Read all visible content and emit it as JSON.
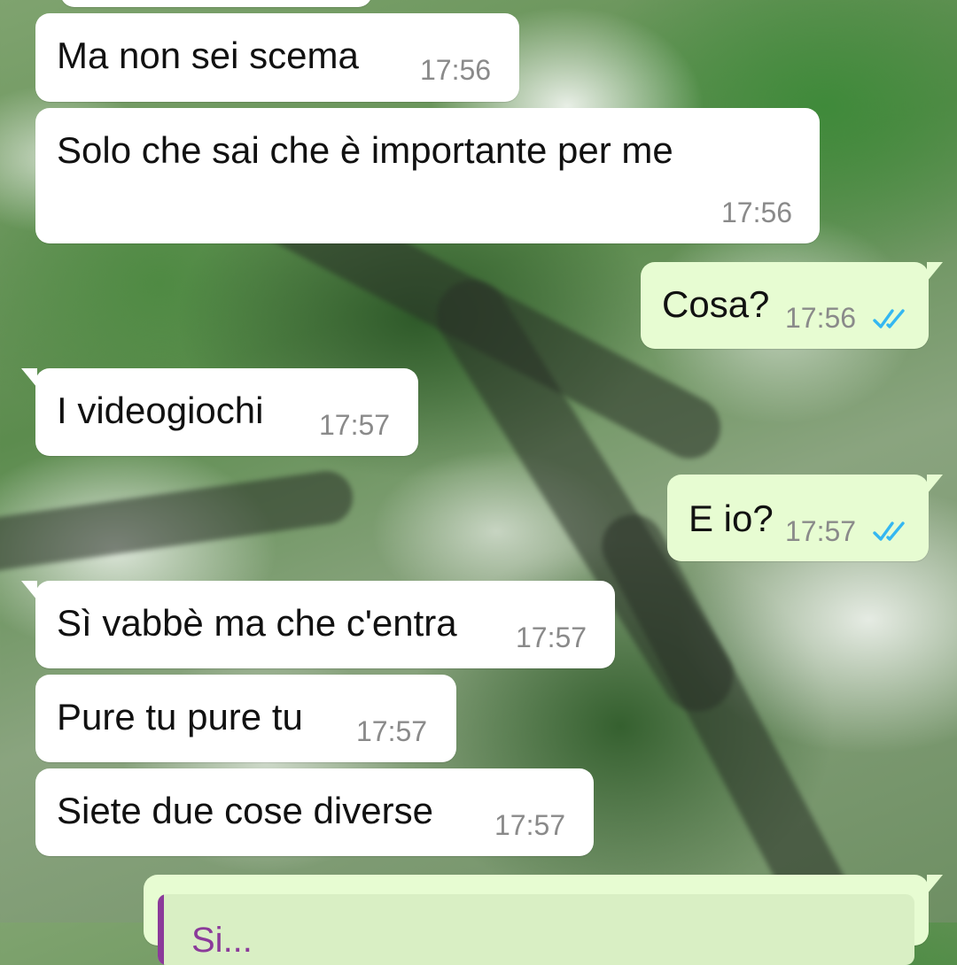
{
  "messages": [
    {
      "text": "Ma non sei scema",
      "time": "17:56"
    },
    {
      "text": "Solo che sai che è importante per me",
      "time": "17:56"
    },
    {
      "text": "Cosa?",
      "time": "17:56"
    },
    {
      "text": "I videogiochi",
      "time": "17:57"
    },
    {
      "text": "E io?",
      "time": "17:57"
    },
    {
      "text": "Sì vabbè ma che c'entra",
      "time": "17:57"
    },
    {
      "text": "Pure tu pure tu",
      "time": "17:57"
    },
    {
      "text": "Siete due cose diverse",
      "time": "17:57"
    }
  ],
  "quoted_reply": {
    "sender": "Si..."
  },
  "colors": {
    "incoming_bubble": "#ffffff",
    "outgoing_bubble": "#e7fcd2",
    "read_ticks": "#34b7f1",
    "reply_accent": "#8b3a9a"
  },
  "icons": {
    "read_receipt": "double-check-icon"
  }
}
